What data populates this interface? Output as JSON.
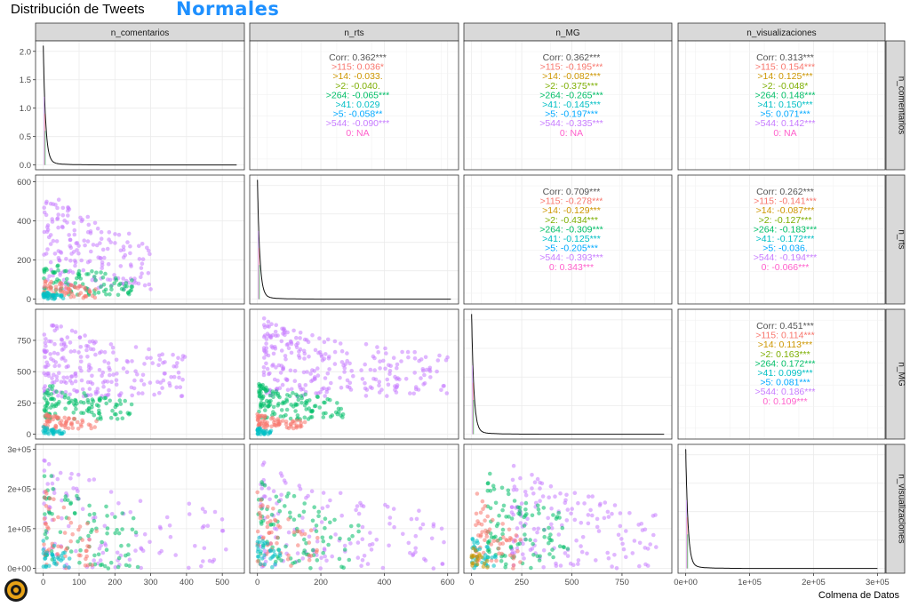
{
  "title": "Distribución de Tweets",
  "subtitle": "Normales",
  "caption": "Colmena de Datos",
  "variables": [
    "n_comentarios",
    "n_rts",
    "n_MG",
    "n_visualizaciones"
  ],
  "group_colors": {
    ">115": "#F8766D",
    ">14": "#CD9600",
    ">2": "#7CAE00",
    ">264": "#00BE67",
    ">41": "#00BFC4",
    ">5": "#00A9FF",
    ">544": "#C77CFF",
    "0": "#FF61CC",
    "Corr": "#555555"
  },
  "chart_data": {
    "type": "scatter-matrix",
    "axes": {
      "n_comentarios": {
        "lim": [
          0,
          540
        ],
        "ticks": [
          0,
          100,
          200,
          300,
          400,
          500
        ],
        "tick_labels": [
          "0",
          "100",
          "200",
          "300",
          "400",
          "500"
        ]
      },
      "n_rts": {
        "lim": [
          0,
          610
        ],
        "ticks": [
          0,
          200,
          400,
          600
        ],
        "tick_labels": [
          "0",
          "200",
          "400",
          "600"
        ]
      },
      "n_MG": {
        "lim": [
          0,
          960
        ],
        "ticks": [
          0,
          250,
          500,
          750
        ],
        "tick_labels": [
          "0",
          "250",
          "500",
          "750"
        ]
      },
      "n_visualizaciones": {
        "lim": [
          0,
          300000
        ],
        "ticks": [
          0,
          100000,
          200000,
          300000
        ],
        "tick_labels": [
          "0e+00",
          "1e+05",
          "2e+05",
          "3e+05"
        ]
      }
    },
    "density_axis": {
      "lim": [
        0,
        2.1
      ],
      "ticks": [
        0,
        0.5,
        1,
        1.5,
        2
      ],
      "tick_labels": [
        "0.0",
        "0.5",
        "1.0",
        "1.5",
        "2.0"
      ]
    },
    "correlations": [
      {
        "pair": [
          "n_comentarios",
          "n_rts"
        ],
        "lines": [
          {
            "group": "Corr",
            "text": "Corr: 0.362***"
          },
          {
            "group": ">115",
            "text": ">115: 0.036*"
          },
          {
            "group": ">14",
            "text": ">14: -0.033."
          },
          {
            "group": ">2",
            "text": ">2: -0.040."
          },
          {
            "group": ">264",
            "text": ">264: -0.065***"
          },
          {
            "group": ">41",
            "text": ">41: 0.029"
          },
          {
            "group": ">5",
            "text": ">5: -0.058**"
          },
          {
            "group": ">544",
            "text": ">544: -0.090***"
          },
          {
            "group": "0",
            "text": "0:   NA"
          }
        ]
      },
      {
        "pair": [
          "n_comentarios",
          "n_MG"
        ],
        "lines": [
          {
            "group": "Corr",
            "text": "Corr: 0.362***"
          },
          {
            "group": ">115",
            "text": ">115: -0.195***"
          },
          {
            "group": ">14",
            "text": ">14: -0.082***"
          },
          {
            "group": ">2",
            "text": ">2: -0.375***"
          },
          {
            "group": ">264",
            "text": ">264: -0.265***"
          },
          {
            "group": ">41",
            "text": ">41: -0.145***"
          },
          {
            "group": ">5",
            "text": ">5: -0.197***"
          },
          {
            "group": ">544",
            "text": ">544: -0.335***"
          },
          {
            "group": "0",
            "text": "0:   NA"
          }
        ]
      },
      {
        "pair": [
          "n_comentarios",
          "n_visualizaciones"
        ],
        "lines": [
          {
            "group": "Corr",
            "text": "Corr: 0.313***"
          },
          {
            "group": ">115",
            "text": ">115: 0.154***"
          },
          {
            "group": ">14",
            "text": ">14: 0.125***"
          },
          {
            "group": ">2",
            "text": ">2: -0.048*"
          },
          {
            "group": ">264",
            "text": ">264: 0.148***"
          },
          {
            "group": ">41",
            "text": ">41: 0.150***"
          },
          {
            "group": ">5",
            "text": ">5: 0.071***"
          },
          {
            "group": ">544",
            "text": ">544: 0.142***"
          },
          {
            "group": "0",
            "text": "0:   NA"
          }
        ]
      },
      {
        "pair": [
          "n_rts",
          "n_MG"
        ],
        "lines": [
          {
            "group": "Corr",
            "text": "Corr: 0.709***"
          },
          {
            "group": ">115",
            "text": ">115: -0.278***"
          },
          {
            "group": ">14",
            "text": ">14: -0.129***"
          },
          {
            "group": ">2",
            "text": ">2: -0.434***"
          },
          {
            "group": ">264",
            "text": ">264: -0.309***"
          },
          {
            "group": ">41",
            "text": ">41: -0.125***"
          },
          {
            "group": ">5",
            "text": ">5: -0.205***"
          },
          {
            "group": ">544",
            "text": ">544: -0.393***"
          },
          {
            "group": "0",
            "text": "0: 0.343***"
          }
        ]
      },
      {
        "pair": [
          "n_rts",
          "n_visualizaciones"
        ],
        "lines": [
          {
            "group": "Corr",
            "text": "Corr: 0.262***"
          },
          {
            "group": ">115",
            "text": ">115: -0.141***"
          },
          {
            "group": ">14",
            "text": ">14: -0.087***"
          },
          {
            "group": ">2",
            "text": ">2: -0.127***"
          },
          {
            "group": ">264",
            "text": ">264: -0.183***"
          },
          {
            "group": ">41",
            "text": ">41: -0.172***"
          },
          {
            "group": ">5",
            "text": ">5: -0.036."
          },
          {
            "group": ">544",
            "text": ">544: -0.194***"
          },
          {
            "group": "0",
            "text": "0: -0.066***"
          }
        ]
      },
      {
        "pair": [
          "n_MG",
          "n_visualizaciones"
        ],
        "lines": [
          {
            "group": "Corr",
            "text": "Corr: 0.451***"
          },
          {
            "group": ">115",
            "text": ">115: 0.114***"
          },
          {
            "group": ">14",
            "text": ">14: 0.113***"
          },
          {
            "group": ">2",
            "text": ">2: 0.163***"
          },
          {
            "group": ">264",
            "text": ">264: 0.172***"
          },
          {
            "group": ">41",
            "text": ">41: 0.099***"
          },
          {
            "group": ">5",
            "text": ">5: 0.081***"
          },
          {
            "group": ">544",
            "text": ">544: 0.186***"
          },
          {
            "group": "0",
            "text": "0: 0.109***"
          }
        ]
      }
    ],
    "scatter_clusters": {
      "n_rts__n_comentarios": [
        {
          "group": ">544",
          "x": [
            2,
            300
          ],
          "y": [
            50,
            590
          ],
          "n": 180
        },
        {
          "group": ">264",
          "x": [
            2,
            250
          ],
          "y": [
            20,
            210
          ],
          "n": 90
        },
        {
          "group": ">115",
          "x": [
            2,
            150
          ],
          "y": [
            5,
            110
          ],
          "n": 60
        },
        {
          "group": ">41",
          "x": [
            0,
            60
          ],
          "y": [
            0,
            40
          ],
          "n": 35
        }
      ],
      "n_MG__n_comentarios": [
        {
          "group": ">544",
          "x": [
            2,
            400
          ],
          "y": [
            300,
            950
          ],
          "n": 220
        },
        {
          "group": ">264",
          "x": [
            2,
            250
          ],
          "y": [
            120,
            420
          ],
          "n": 110
        },
        {
          "group": ">115",
          "x": [
            2,
            150
          ],
          "y": [
            40,
            170
          ],
          "n": 60
        },
        {
          "group": ">41",
          "x": [
            0,
            60
          ],
          "y": [
            0,
            60
          ],
          "n": 30
        }
      ],
      "n_MG__n_rts": [
        {
          "group": ">544",
          "x": [
            20,
            600
          ],
          "y": [
            300,
            950
          ],
          "n": 260
        },
        {
          "group": ">264",
          "x": [
            5,
            280
          ],
          "y": [
            120,
            420
          ],
          "n": 130
        },
        {
          "group": ">115",
          "x": [
            0,
            150
          ],
          "y": [
            40,
            170
          ],
          "n": 70
        },
        {
          "group": ">41",
          "x": [
            0,
            50
          ],
          "y": [
            0,
            60
          ],
          "n": 30
        }
      ],
      "n_visualizaciones__n_comentarios": [
        {
          "group": ">544",
          "x": [
            2,
            520
          ],
          "y": [
            0,
            290000
          ],
          "n": 110
        },
        {
          "group": ">264",
          "x": [
            2,
            290
          ],
          "y": [
            0,
            260000
          ],
          "n": 80
        },
        {
          "group": ">115",
          "x": [
            2,
            150
          ],
          "y": [
            0,
            220000
          ],
          "n": 55
        },
        {
          "group": ">41",
          "x": [
            0,
            80
          ],
          "y": [
            0,
            80000
          ],
          "n": 30
        }
      ],
      "n_visualizaciones__n_rts": [
        {
          "group": ">544",
          "x": [
            10,
            590
          ],
          "y": [
            0,
            280000
          ],
          "n": 130
        },
        {
          "group": ">264",
          "x": [
            2,
            320
          ],
          "y": [
            0,
            250000
          ],
          "n": 85
        },
        {
          "group": ">115",
          "x": [
            0,
            200
          ],
          "y": [
            0,
            200000
          ],
          "n": 55
        },
        {
          "group": ">41",
          "x": [
            0,
            80
          ],
          "y": [
            0,
            90000
          ],
          "n": 30
        }
      ],
      "n_visualizaciones__n_MG": [
        {
          "group": ">544",
          "x": [
            200,
            930
          ],
          "y": [
            0,
            280000
          ],
          "n": 150
        },
        {
          "group": ">264",
          "x": [
            80,
            480
          ],
          "y": [
            0,
            260000
          ],
          "n": 100
        },
        {
          "group": ">115",
          "x": [
            20,
            250
          ],
          "y": [
            0,
            200000
          ],
          "n": 60
        },
        {
          "group": ">41",
          "x": [
            0,
            120
          ],
          "y": [
            0,
            90000
          ],
          "n": 35
        },
        {
          "group": ">14",
          "x": [
            0,
            80
          ],
          "y": [
            0,
            60000
          ],
          "n": 20
        }
      ]
    },
    "density_note": "diagonal panels show density curves concentrated near zero"
  }
}
